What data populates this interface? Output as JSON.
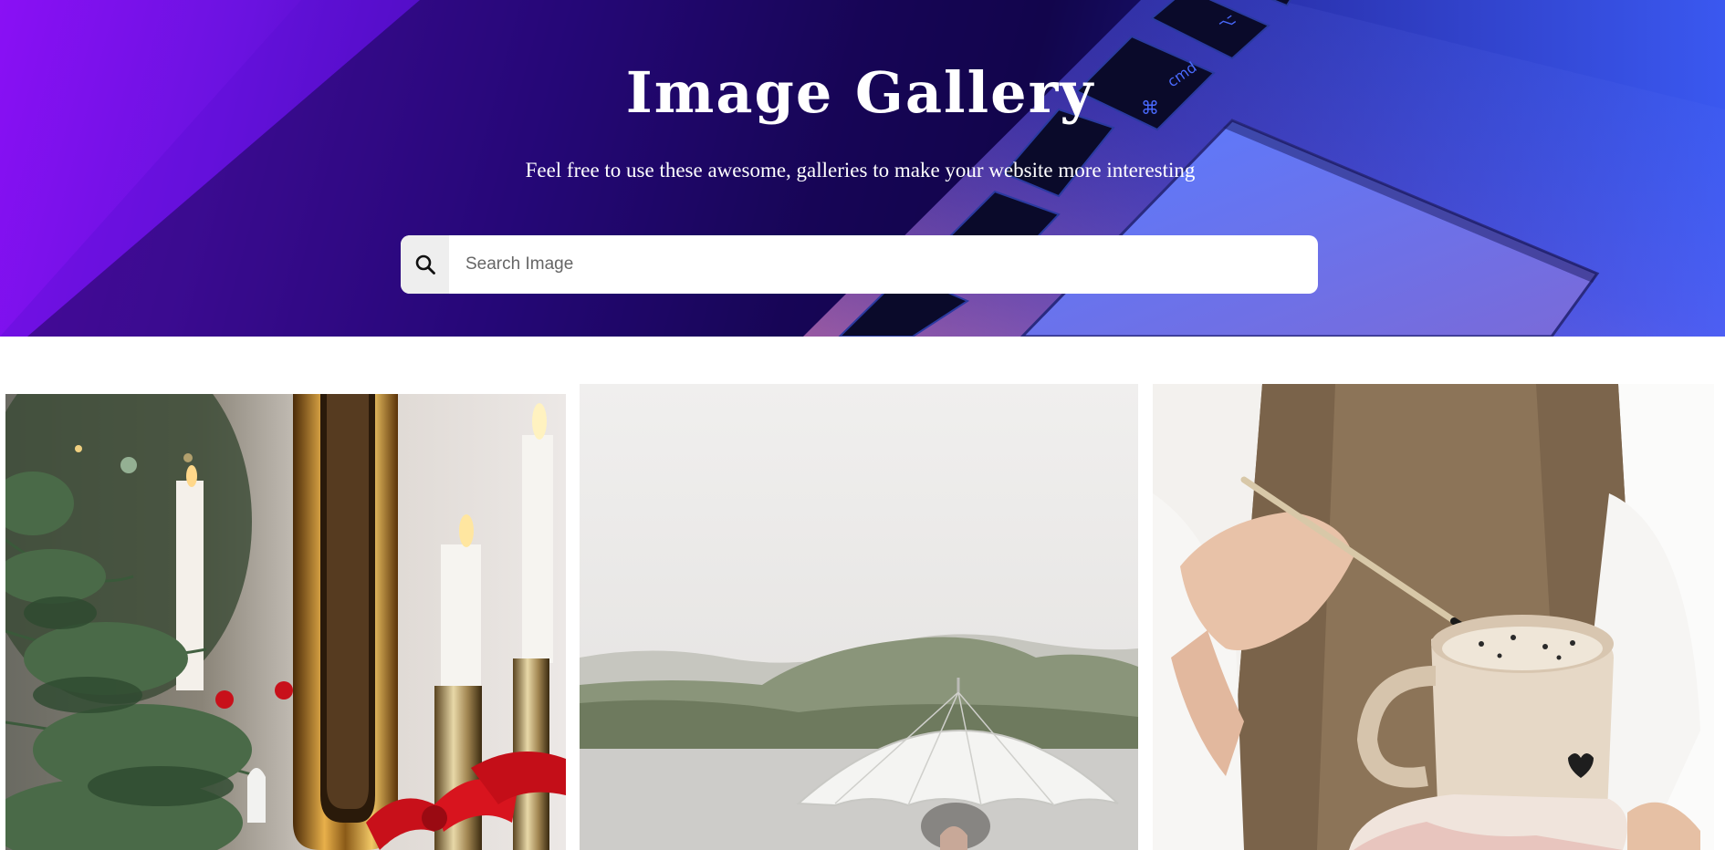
{
  "hero": {
    "title": "Image Gallery",
    "subtitle": "Feel free to use these awesome, galleries to make your website more interesting"
  },
  "search": {
    "placeholder": "Search Image",
    "value": "",
    "icon": "search-icon"
  },
  "gallery": {
    "images": [
      {
        "subject": "christmas-candles-mirror"
      },
      {
        "subject": "white-umbrella-lake"
      },
      {
        "subject": "pottery-painting"
      }
    ]
  },
  "colors": {
    "hero_purple": "#8a10f5",
    "hero_navy": "#10064a",
    "hero_blue": "#4a78ff",
    "search_bg": "#ffffff",
    "search_button_bg": "#eeeeee"
  }
}
